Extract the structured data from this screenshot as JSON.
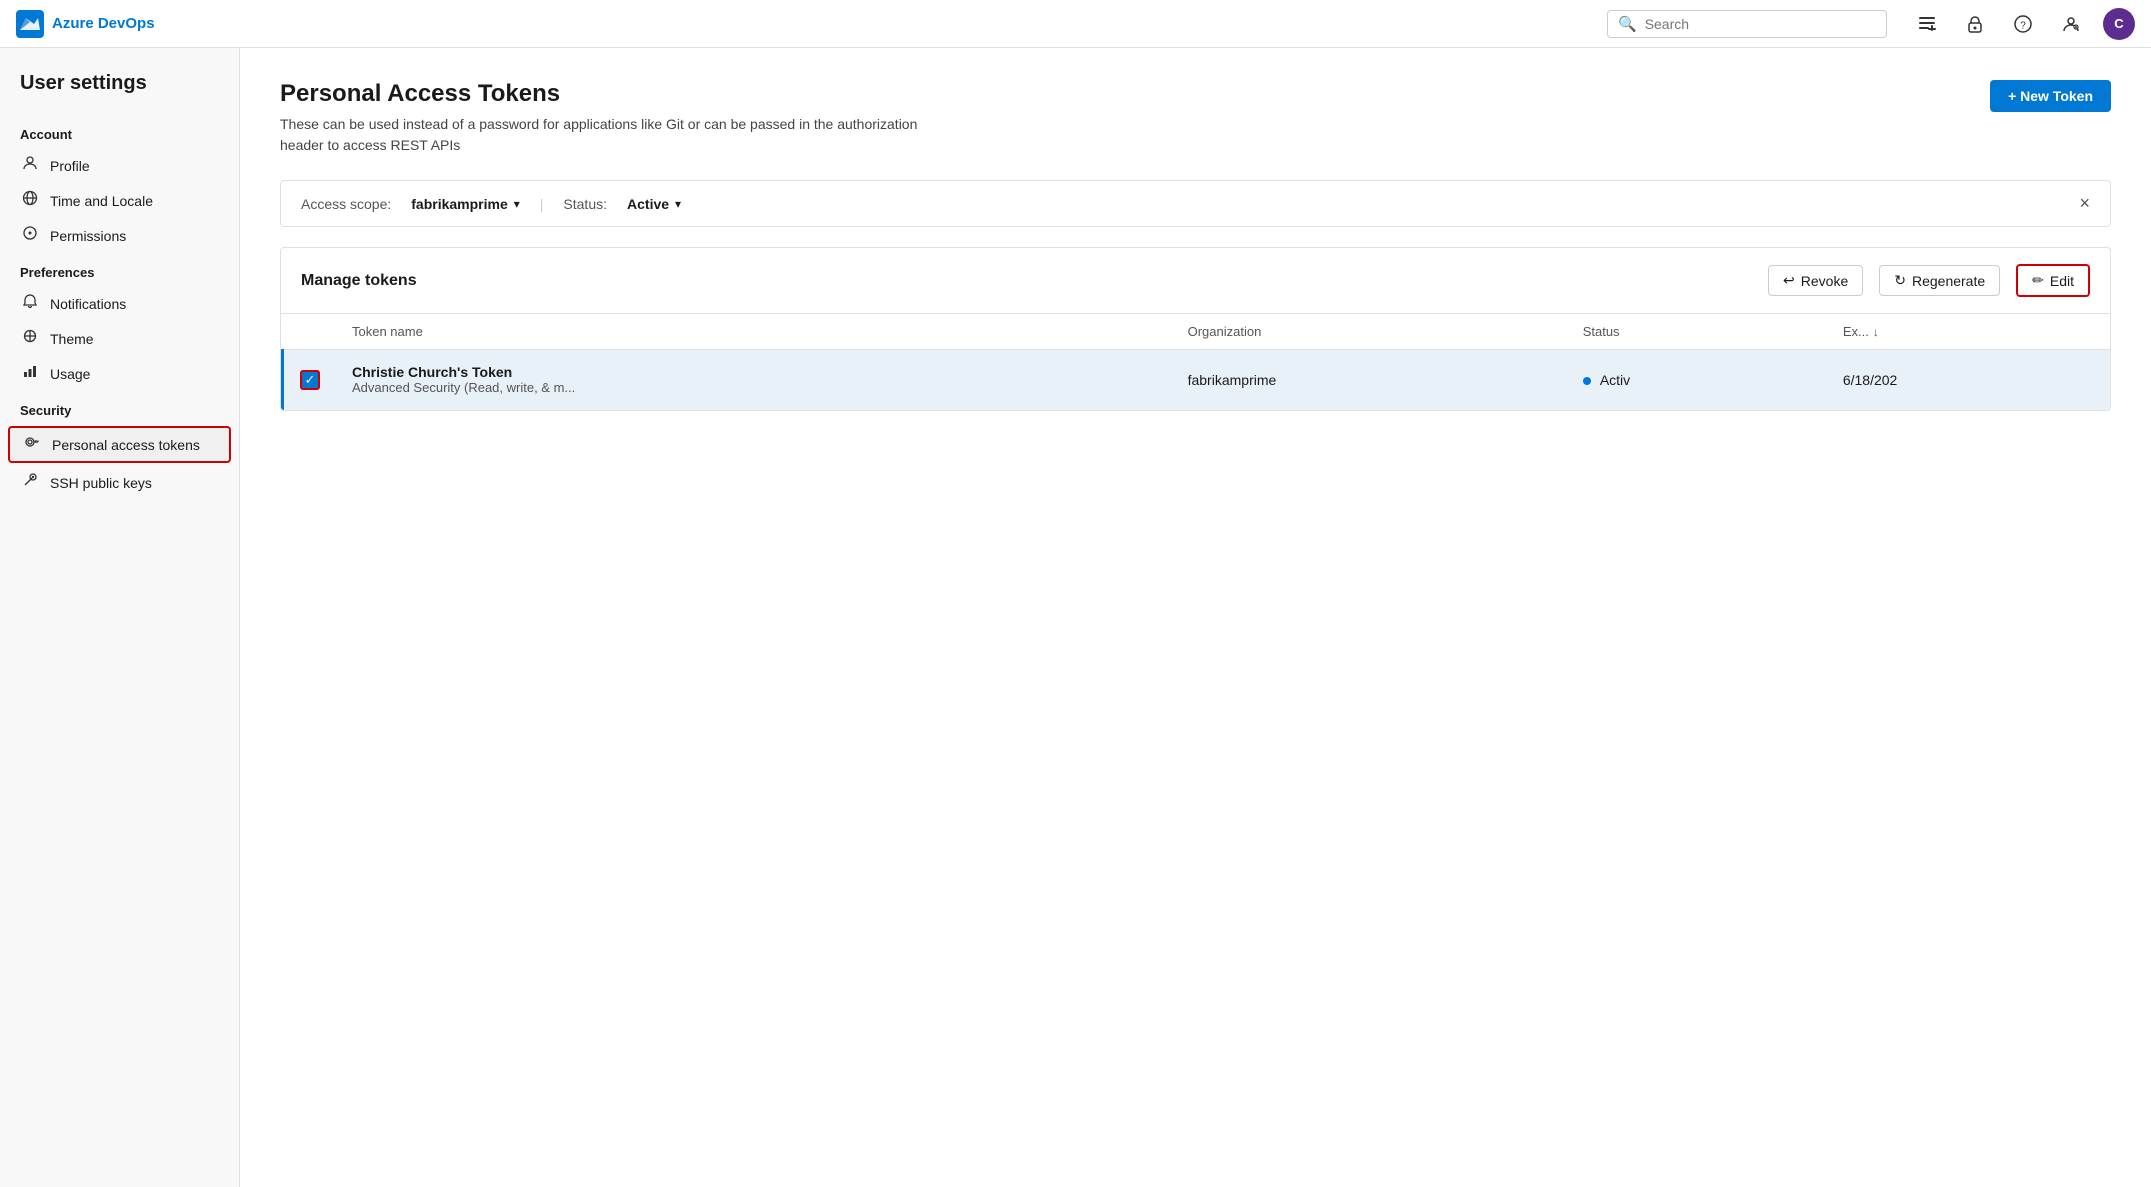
{
  "app": {
    "name": "Azure DevOps",
    "logo_color": "#0078d4"
  },
  "topnav": {
    "search_placeholder": "Search",
    "search_value": ""
  },
  "sidebar": {
    "title": "User settings",
    "sections": [
      {
        "header": "Account",
        "items": [
          {
            "id": "profile",
            "label": "Profile",
            "icon": "👤"
          },
          {
            "id": "time-locale",
            "label": "Time and Locale",
            "icon": "🌐"
          },
          {
            "id": "permissions",
            "label": "Permissions",
            "icon": "↻"
          }
        ]
      },
      {
        "header": "Preferences",
        "items": [
          {
            "id": "notifications",
            "label": "Notifications",
            "icon": "🔔"
          },
          {
            "id": "theme",
            "label": "Theme",
            "icon": "🎨"
          },
          {
            "id": "usage",
            "label": "Usage",
            "icon": "📊"
          }
        ]
      },
      {
        "header": "Security",
        "items": [
          {
            "id": "personal-access-tokens",
            "label": "Personal access tokens",
            "icon": "🔑",
            "active": true
          },
          {
            "id": "ssh-public-keys",
            "label": "SSH public keys",
            "icon": "🔒"
          }
        ]
      }
    ]
  },
  "main": {
    "page_title": "Personal Access Tokens",
    "page_subtitle": "These can be used instead of a password for applications like Git or can be passed in the authorization header to access REST APIs",
    "new_token_btn": "+ New Token",
    "filter_bar": {
      "access_scope_label": "Access scope:",
      "access_scope_value": "fabrikamprime",
      "status_label": "Status:",
      "status_value": "Active"
    },
    "token_section": {
      "title": "Manage tokens",
      "actions": [
        {
          "id": "revoke",
          "label": "Revoke",
          "icon": "↩"
        },
        {
          "id": "regenerate",
          "label": "Regenerate",
          "icon": "↻"
        },
        {
          "id": "edit",
          "label": "Edit",
          "icon": "✏",
          "highlighted": true
        }
      ],
      "table": {
        "columns": [
          {
            "id": "checkbox",
            "label": ""
          },
          {
            "id": "token-name",
            "label": "Token name"
          },
          {
            "id": "organization",
            "label": "Organization"
          },
          {
            "id": "status",
            "label": "Status"
          },
          {
            "id": "expiry",
            "label": "Ex...",
            "sortable": true,
            "sort_dir": "desc"
          }
        ],
        "rows": [
          {
            "id": "row1",
            "selected": true,
            "token_name": "Christie Church's Token",
            "token_desc": "Advanced Security (Read, write, & m...",
            "organization": "fabrikamprime",
            "status": "Activ",
            "status_active": true,
            "expiry": "6/18/202"
          }
        ]
      }
    }
  }
}
